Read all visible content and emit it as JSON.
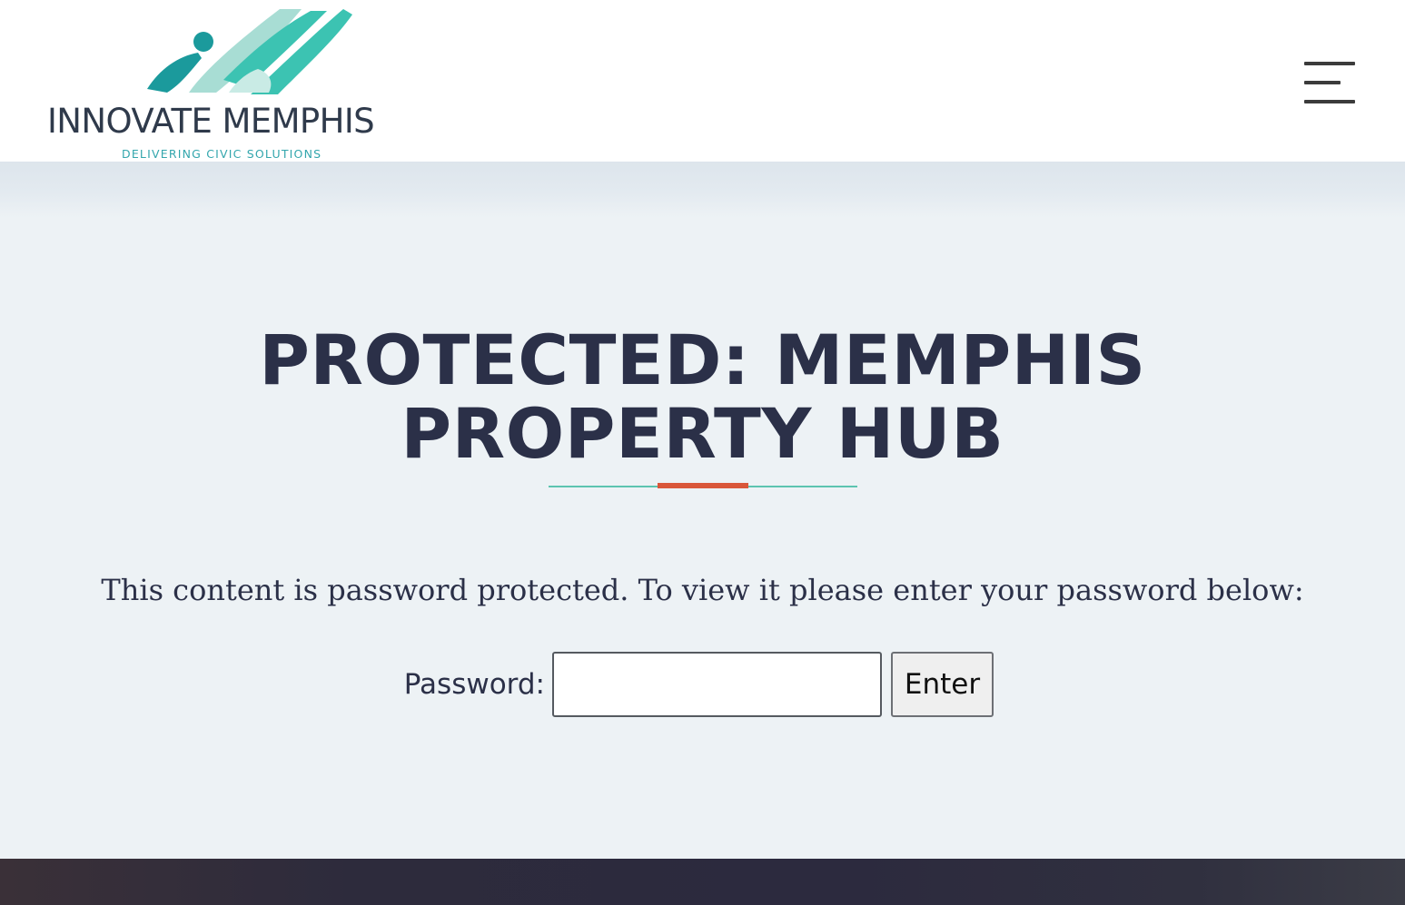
{
  "header": {
    "logo": {
      "wordmark": "INNOVATE MEMPHIS",
      "tagline": "DELIVERING CIVIC SOLUTIONS",
      "mark_colors": [
        "#1b9a9c",
        "#3cc3b2",
        "#a8ddd4"
      ]
    },
    "menu_icon": "hamburger-menu-icon"
  },
  "main": {
    "title": "PROTECTED: MEMPHIS PROPERTY HUB",
    "intro": "This content is password protected. To view it please enter your password below:",
    "form": {
      "password_label": "Password:",
      "password_value": "",
      "submit_label": "Enter"
    }
  },
  "colors": {
    "heading": "#2b3048",
    "background": "#edf2f5",
    "accent_rule": "#d9573a",
    "teal_rule": "#5cc4b0",
    "footer": "#2d2b3c"
  }
}
